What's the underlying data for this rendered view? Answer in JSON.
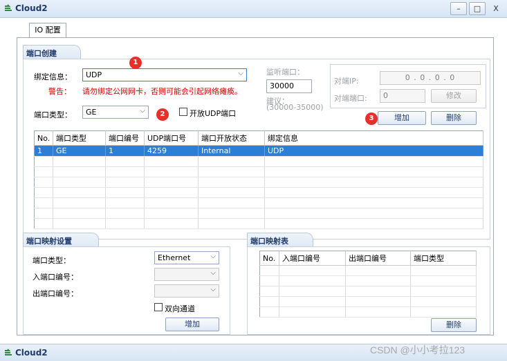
{
  "window": {
    "title": "Cloud2",
    "minimize": "–",
    "maximize": "□",
    "close": "X"
  },
  "tab": {
    "label": "IO 配置"
  },
  "port_create": {
    "header": "端口创建",
    "bind_label": "绑定信息：",
    "bind_value": "UDP",
    "warning_label": "警告：",
    "warning_text": "请勿绑定公网网卡，否则可能会引起网络瘫痪。",
    "port_type_label": "端口类型：",
    "port_type_value": "GE",
    "open_udp_label": "开放UDP端口",
    "listen_label": "监听端口：",
    "listen_value": "30000",
    "suggest_label": "建议：",
    "suggest_range": "(30000-35000)",
    "peer_ip_label": "对端IP:",
    "peer_ip_value": "0 . 0 . 0 . 0",
    "peer_port_label": "对端端口:",
    "peer_port_value": "0",
    "modify_button": "修改",
    "add_button": "增加",
    "delete_button": "删除",
    "badges": [
      "1",
      "2",
      "3"
    ]
  },
  "port_table": {
    "columns": [
      "No.",
      "端口类型",
      "端口编号",
      "UDP端口号",
      "端口开放状态",
      "绑定信息"
    ],
    "rows": [
      [
        "1",
        "GE",
        "1",
        "4259",
        "Internal",
        "UDP"
      ]
    ]
  },
  "port_mapping": {
    "header": "端口映射设置",
    "type_label": "端口类型：",
    "type_value": "Ethernet",
    "in_label": "入端口编号：",
    "out_label": "出端口编号：",
    "bidirectional_label": "双向通道",
    "add_button": "增加"
  },
  "mapping_table": {
    "header": "端口映射表",
    "columns": [
      "No.",
      "入端口编号",
      "出端口编号",
      "端口类型"
    ],
    "delete_button": "删除"
  },
  "taskbar": {
    "title": "Cloud2"
  },
  "watermark": "CSDN @小小考拉123",
  "colors": {
    "selection": "#2b7fd6",
    "badge": "#e8302a",
    "warning": "#d40000"
  }
}
